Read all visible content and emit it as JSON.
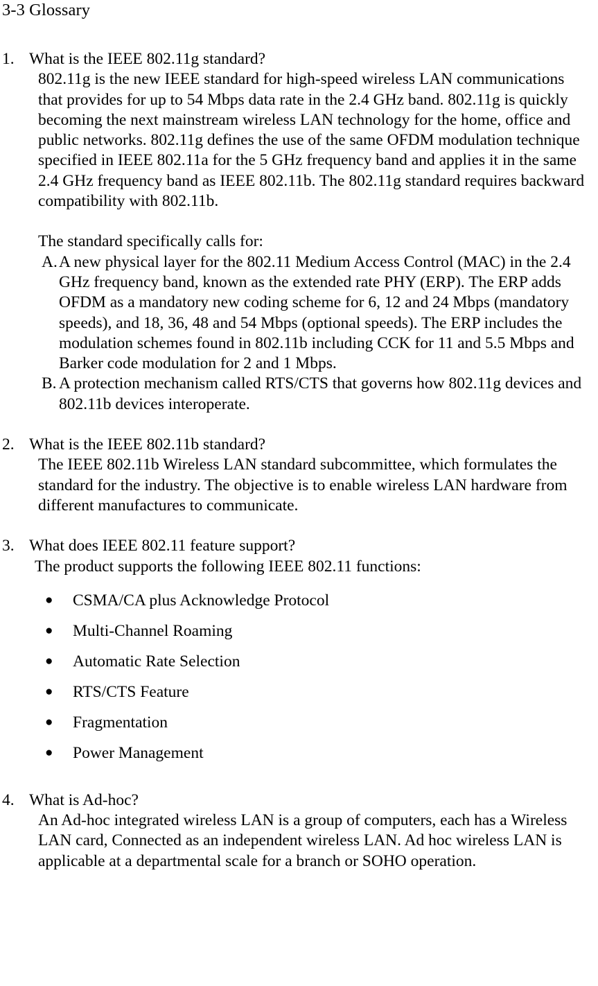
{
  "page": {
    "title": "3-3 Glossary"
  },
  "faq": [
    {
      "number": "1.",
      "question": "What is the IEEE 802.11g standard?",
      "answer": "802.11g is the new IEEE standard for high-speed wireless LAN communications that provides for up to 54 Mbps data rate in the 2.4 GHz band. 802.11g is quickly becoming the next mainstream wireless LAN technology for the home, office and public networks. 802.11g defines the use of the same OFDM modulation technique specified in IEEE 802.11a for the 5 GHz frequency band and applies it in the same 2.4 GHz frequency band as IEEE 802.11b. The 802.11g standard requires backward compatibility with 802.11b.",
      "sub_intro": "The standard specifically calls for:",
      "sub_items": [
        {
          "marker": "A.",
          "text": "A new physical layer for the 802.11 Medium Access Control (MAC) in the 2.4 GHz frequency band, known as the extended rate PHY (ERP). The ERP adds OFDM as a mandatory new coding scheme for 6, 12 and 24 Mbps (mandatory speeds), and 18, 36, 48 and 54 Mbps (optional speeds). The ERP includes the modulation schemes found in 802.11b including CCK for 11 and 5.5 Mbps and Barker code modulation for 2 and 1 Mbps."
        },
        {
          "marker": "B.",
          "text": "A protection mechanism called RTS/CTS that governs how 802.11g devices and 802.11b devices interoperate."
        }
      ]
    },
    {
      "number": "2.",
      "question": "What is the IEEE 802.11b standard?",
      "answer": "The IEEE 802.11b Wireless LAN standard subcommittee, which formulates the standard for the industry. The objective is to enable wireless LAN hardware from different manufactures to communicate."
    },
    {
      "number": "3.",
      "question": "What does IEEE 802.11 feature support?",
      "answer": "The product supports the following IEEE 802.11 functions:",
      "features": [
        "CSMA/CA plus Acknowledge Protocol",
        "Multi-Channel Roaming",
        "Automatic Rate Selection",
        "RTS/CTS Feature",
        "Fragmentation",
        "Power Management"
      ],
      "bullet_glyph": "●"
    },
    {
      "number": "4.",
      "question": "What is Ad-hoc?",
      "answer": "An Ad-hoc integrated wireless LAN is a group of computers, each has a Wireless LAN card, Connected as an independent wireless LAN. Ad hoc wireless LAN is applicable at a departmental scale for a branch or SOHO operation."
    }
  ]
}
